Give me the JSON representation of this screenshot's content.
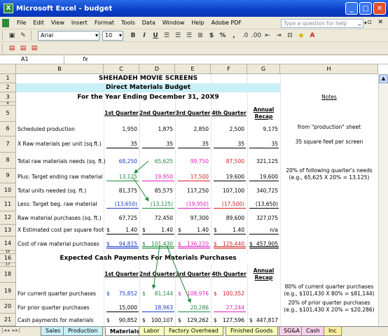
{
  "window": {
    "title": "Microsoft Excel - budget"
  },
  "menu": [
    "File",
    "Edit",
    "View",
    "Insert",
    "Format",
    "Tools",
    "Data",
    "Window",
    "Help",
    "Adobe PDF"
  ],
  "help_box": {
    "placeholder": "Type a question for help"
  },
  "toolbar": {
    "font": "Arial",
    "size": "10",
    "bold": "B",
    "italic": "I",
    "underline": "U",
    "currency": "$",
    "percent": "%",
    "comma": ","
  },
  "formula_bar": {
    "name_box": "A1",
    "fx": "fx",
    "content": ""
  },
  "columns": [
    "B",
    "C",
    "D",
    "E",
    "F",
    "G",
    "H"
  ],
  "rows": [
    "1",
    "2",
    "3",
    "4",
    "5",
    "6",
    "7",
    "8",
    "9",
    "10",
    "11",
    "12",
    "13",
    "14",
    "15",
    "16",
    "17",
    "18",
    "19",
    "20",
    "21"
  ],
  "sheet": {
    "title1": "SHEHADEH MOVIE SCREENS",
    "title2": "Direct Materials Budget",
    "title3": "For the Year Ending December 31, 20X9",
    "notes": "Notes",
    "q_headers": [
      "1st Quarter",
      "2nd Quarter",
      "3rd Quarter",
      "4th Quarter"
    ],
    "annual": "Annual",
    "recap": "Recap",
    "r6": {
      "label": "Scheduled production",
      "v": [
        "1,950",
        "1,875",
        "2,850",
        "2,500",
        "9,175"
      ],
      "note": "from \"production\" sheet"
    },
    "r7": {
      "label": "X Raw materials per unit (sq.ft.)",
      "v": [
        "35",
        "35",
        "35",
        "35",
        "35"
      ],
      "note": "35 square feet per screen"
    },
    "r8": {
      "label": "Total raw materials needs (sq. ft.)",
      "v": [
        "68,250",
        "65,625",
        "99,750",
        "87,500",
        "321,125"
      ]
    },
    "r9": {
      "label": "Plus: Target ending raw material",
      "v": [
        "13,125",
        "19,950",
        "17,500",
        "19,600",
        "19,600"
      ],
      "note1": "20% of following quarter's needs",
      "note2": "(e.g., 65,625 X 20% = 13,125)"
    },
    "r10": {
      "label": "Total units needed (sq. ft.)",
      "v": [
        "81,375",
        "85,575",
        "117,250",
        "107,100",
        "340,725"
      ]
    },
    "r11": {
      "label": "Less: Target beg. raw material",
      "v": [
        "(13,650)",
        "(13,125)",
        "(19,950)",
        "(17,500)",
        "(13,650)"
      ]
    },
    "r12": {
      "label": "Raw material purchases (sq. ft.)",
      "v": [
        "67,725",
        "72,450",
        "97,300",
        "89,600",
        "327,075"
      ]
    },
    "r13": {
      "label": "X Estimated cost per square foot",
      "v": [
        "1.40",
        "1.40",
        "1.40",
        "1.40",
        "n/a"
      ],
      "cur": "$"
    },
    "r14": {
      "label": "Cost of raw material purchases",
      "v": [
        "94,815",
        "101,430",
        "136,220",
        "125,440",
        "457,905"
      ],
      "cur": "$"
    },
    "title16": "Expected Cash Payments For Materials Purchases",
    "r19": {
      "label": "For current quarter purchases",
      "v": [
        "75,852",
        "81,144",
        "108,976",
        "100,352"
      ],
      "cur": "$",
      "note1": "80% of current quarter purchases",
      "note2": "(e.g., $101,430 X 80% = $81,144)"
    },
    "r20": {
      "label": "For prior quarter purchases",
      "v": [
        "15,000",
        "18,963",
        "20,286",
        "27,244"
      ],
      "note1": "20% of prior quarter purchases",
      "note2": "(e.g., $101,430 X 20% = $20,286)"
    },
    "r21": {
      "label": "Cash payments for materials",
      "v": [
        "90,852",
        "100,107",
        "129,262",
        "127,596",
        "447,817"
      ],
      "cur": "$"
    }
  },
  "sheet_tabs": [
    "Sales",
    "Production",
    "Materials",
    "Labor",
    "Factory Overhead",
    "Finished Goods",
    "SG&A",
    "Cash",
    "Inc"
  ],
  "tab_colors": {
    "Sales": "#c8f0f8",
    "Production": "#c8f0f8",
    "Materials": "#ffffff",
    "Labor": "#f8ffb8",
    "Factory Overhead": "#f8ffb8",
    "Finished Goods": "#f8ffb8",
    "SG&A": "#f8d0e8",
    "Cash": "#f8d0e8",
    "Inc": "#fff0a0"
  }
}
